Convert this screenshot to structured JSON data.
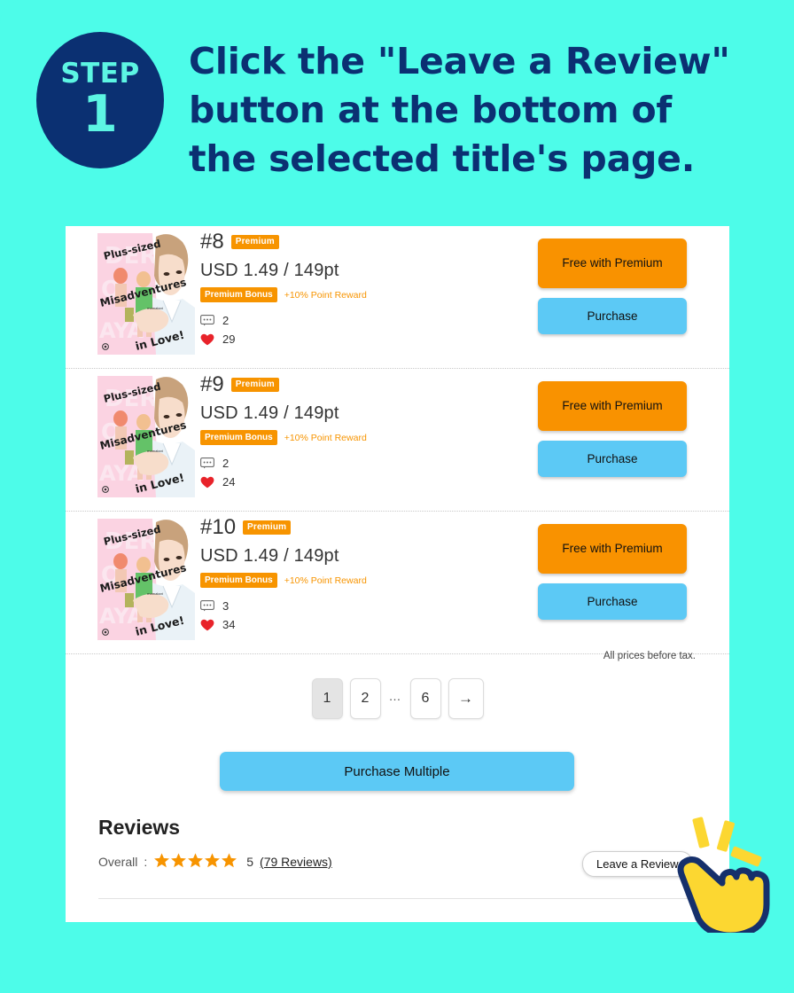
{
  "theme": {
    "background": "#4DFCE9",
    "navy": "#0B3072",
    "orange": "#F79400",
    "blue": "#5CC9F5",
    "star": "#F79400",
    "heart": "#E8232A"
  },
  "header": {
    "step_word": "STEP",
    "step_number": "1",
    "headline_lines": [
      "Click the \"Leave a Review\"",
      "button at the bottom of",
      "the selected title's page."
    ]
  },
  "products": [
    {
      "cover_title_lines": [
        "Plus-sized",
        "Misadventures",
        "in Love!"
      ],
      "cover_author": "mamakari",
      "number": "#8",
      "premium_badge": "Premium",
      "price": "USD 1.49 / 149pt",
      "bonus_badge": "Premium Bonus",
      "bonus_text": "+10% Point Reward",
      "comment_icon": "comment-icon",
      "comments": "2",
      "heart_icon": "heart-icon",
      "likes": "29",
      "free_button": "Free with Premium",
      "purchase_button": "Purchase"
    },
    {
      "cover_title_lines": [
        "Plus-sized",
        "Misadventures",
        "in Love!"
      ],
      "cover_author": "mamakari",
      "number": "#9",
      "premium_badge": "Premium",
      "price": "USD 1.49 / 149pt",
      "bonus_badge": "Premium Bonus",
      "bonus_text": "+10% Point Reward",
      "comment_icon": "comment-icon",
      "comments": "2",
      "heart_icon": "heart-icon",
      "likes": "24",
      "free_button": "Free with Premium",
      "purchase_button": "Purchase"
    },
    {
      "cover_title_lines": [
        "Plus-sized",
        "Misadventures",
        "in Love!"
      ],
      "cover_author": "mamakari",
      "number": "#10",
      "premium_badge": "Premium",
      "price": "USD 1.49 / 149pt",
      "bonus_badge": "Premium Bonus",
      "bonus_text": "+10% Point Reward",
      "comment_icon": "comment-icon",
      "comments": "3",
      "heart_icon": "heart-icon",
      "likes": "34",
      "free_button": "Free with Premium",
      "purchase_button": "Purchase"
    }
  ],
  "tax_note": "All prices before tax.",
  "pagination": {
    "pages": [
      "1",
      "2"
    ],
    "ellipsis": "…",
    "last_page": "6",
    "next_arrow": "→",
    "active_page": "1"
  },
  "purchase_multiple_button": "Purchase Multiple",
  "reviews": {
    "title": "Reviews",
    "overall_label": "Overall :",
    "star_count": 5,
    "score": "5",
    "reviews_link": "(79 Reviews)",
    "leave_review_button": "Leave a Review"
  },
  "cursor": {
    "icon": "pointing-hand-cursor"
  }
}
